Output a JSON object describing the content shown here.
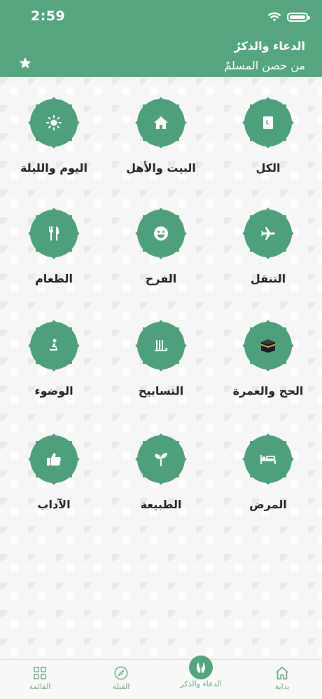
{
  "status_bar": {
    "time": "2:59"
  },
  "header": {
    "title": "الدعاء والذكرُ",
    "subtitle": "من حصن المسلمٌ"
  },
  "categories": [
    {
      "label": "الكل",
      "icon": "quran-book-icon"
    },
    {
      "label": "البيت والأهل",
      "icon": "house-icon"
    },
    {
      "label": "اليوم والليلة",
      "icon": "sun-icon"
    },
    {
      "label": "التنقل",
      "icon": "airplane-icon"
    },
    {
      "label": "الفرح",
      "icon": "smile-icon"
    },
    {
      "label": "الطعام",
      "icon": "fork-knife-icon"
    },
    {
      "label": "الحج والعمرة",
      "icon": "kaaba-icon"
    },
    {
      "label": "التسابيح",
      "icon": "allah-calligraphy-icon"
    },
    {
      "label": "الوضوء",
      "icon": "praying-person-icon"
    },
    {
      "label": "المرض",
      "icon": "bed-icon"
    },
    {
      "label": "الطبيعة",
      "icon": "sprout-icon"
    },
    {
      "label": "الآداب",
      "icon": "thumbs-up-icon"
    }
  ],
  "tabs": [
    {
      "label": "بداية",
      "icon": "home-icon"
    },
    {
      "label": "الدعاء والذكر",
      "icon": "dua-hands-icon",
      "active": true
    },
    {
      "label": "القبلة",
      "icon": "compass-icon"
    },
    {
      "label": "القائمة",
      "icon": "grid-icon"
    }
  ],
  "colors": {
    "brand_green": "#55a57f",
    "badge_green": "#4e9f7b",
    "tab_icon": "#6aaa8a"
  }
}
